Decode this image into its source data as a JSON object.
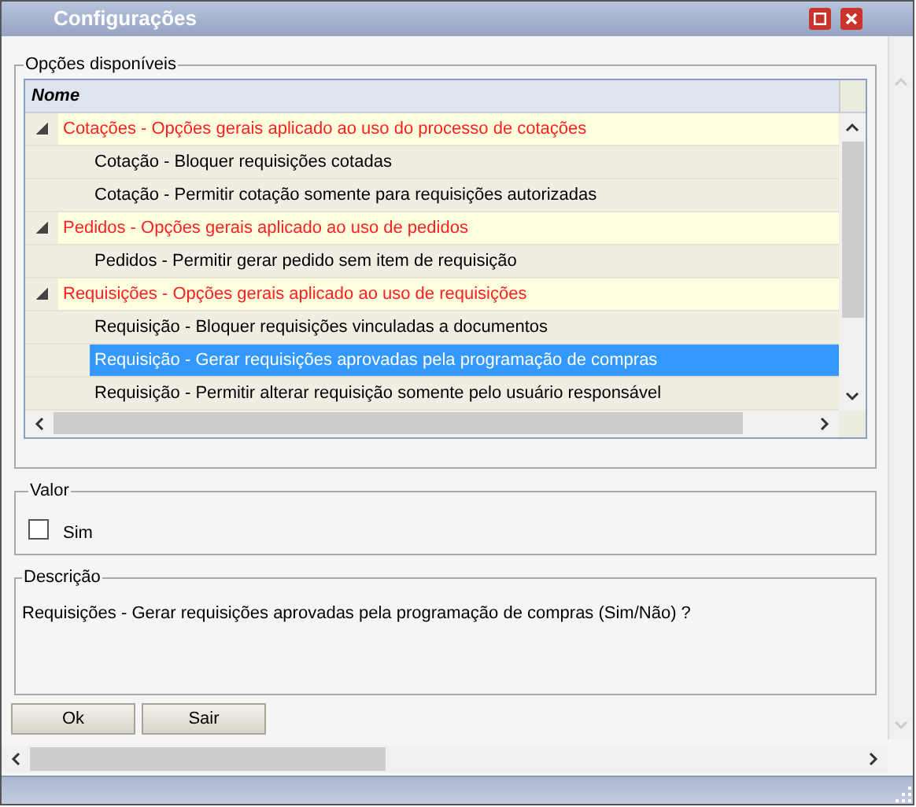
{
  "window": {
    "title": "Configurações"
  },
  "options": {
    "legend": "Opções disponíveis",
    "column": "Nome",
    "groups": [
      {
        "label": "Cotações - Opções gerais aplicado ao uso do processo de cotações",
        "expanded": true,
        "children": [
          {
            "label": "Cotação - Bloquer requisições cotadas",
            "selected": false
          },
          {
            "label": "Cotação - Permitir cotação somente para requisições autorizadas",
            "selected": false
          }
        ]
      },
      {
        "label": "Pedidos - Opções gerais aplicado ao uso de pedidos",
        "expanded": true,
        "children": [
          {
            "label": "Pedidos - Permitir gerar pedido sem item de requisição",
            "selected": false
          }
        ]
      },
      {
        "label": "Requisições - Opções gerais aplicado ao uso de requisições",
        "expanded": true,
        "children": [
          {
            "label": "Requisição - Bloquer requisições vinculadas a documentos",
            "selected": false
          },
          {
            "label": "Requisição - Gerar requisições aprovadas pela programação de compras",
            "selected": true
          },
          {
            "label": "Requisição - Permitir alterar requisição somente pelo usuário responsável",
            "selected": false
          }
        ]
      }
    ]
  },
  "value": {
    "legend": "Valor",
    "label": "Sim",
    "checked": false
  },
  "description": {
    "legend": "Descrição",
    "text": "Requisições - Gerar requisições aprovadas pela programação de compras (Sim/Não) ?"
  },
  "buttons": [
    "Ok",
    "Sair"
  ]
}
